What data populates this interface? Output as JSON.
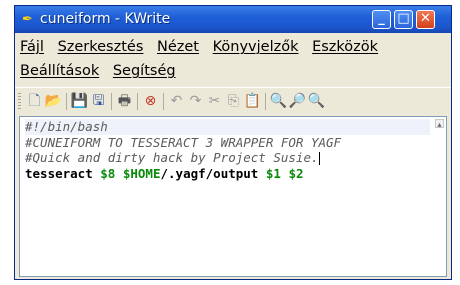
{
  "window": {
    "title": "cuneiform - KWrite",
    "controls": {
      "minimize": "_",
      "maximize": "□",
      "close": "✕"
    }
  },
  "menu": {
    "row1": [
      "Fájl",
      "Szerkesztés",
      "Nézet",
      "Könyvjelzők",
      "Eszközök"
    ],
    "row2": [
      "Beállítások",
      "Segítség"
    ]
  },
  "toolbar": {
    "icons": [
      "new-file-icon",
      "open-folder-icon",
      "save-icon",
      "save-as-icon",
      "print-icon",
      "close-doc-icon",
      "undo-icon",
      "redo-icon",
      "cut-icon",
      "copy-icon",
      "paste-icon",
      "find-icon",
      "find-next-icon",
      "find-prev-icon"
    ],
    "glyphs": [
      "🗋",
      "📂",
      "💾",
      "🖫",
      "🖶",
      "⊗",
      "↶",
      "↷",
      "✂",
      "⎘",
      "📋",
      "🔍",
      "🔎",
      "🔍"
    ]
  },
  "editor": {
    "lines": [
      "#!/bin/bash",
      "#CUNEIFORM TO TESSERACT 3 WRAPPER FOR YAGF",
      "#Quick and dirty hack by Project Susie.",
      "tesseract $8 $HOME/.yagf/output $1 $2"
    ],
    "line4_parts": {
      "cmd": "tesseract ",
      "v8": "$8",
      "sp1": " ",
      "vhome": "$HOME",
      "path": "/.yagf/output ",
      "v1": "$1",
      "sp2": " ",
      "v2": "$2"
    }
  }
}
